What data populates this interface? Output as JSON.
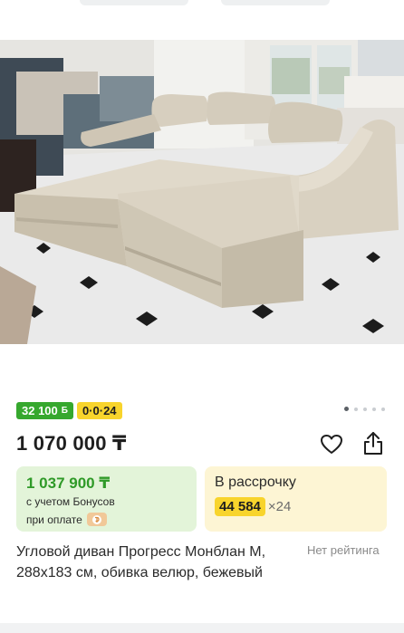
{
  "product": {
    "bonus_badge": {
      "value": "32 100",
      "icon": "bonus-coin-icon"
    },
    "installment_badge": "0·0·24",
    "carousel": {
      "total": 5,
      "active": 0
    },
    "price": "1 070 000 ₸",
    "bonus_price": {
      "value": "1 037 900 ₸",
      "line1": "с учетом Бонусов",
      "line2": "при оплате",
      "icon": "wallet-icon"
    },
    "installment": {
      "title": "В рассрочку",
      "amount": "44 584",
      "months": "×24"
    },
    "title": "Угловой диван Прогресс Монблан М, 288x183 см, обивка велюр, бежевый",
    "rating": "Нет рейтинга",
    "icons": {
      "favorite": "heart-icon",
      "share": "share-icon"
    }
  },
  "colors": {
    "bonus_green": "#36a82e",
    "installment_yellow": "#f8d42c",
    "green_card_bg": "#e3f4d9",
    "yellow_card_bg": "#fdf5d4"
  }
}
